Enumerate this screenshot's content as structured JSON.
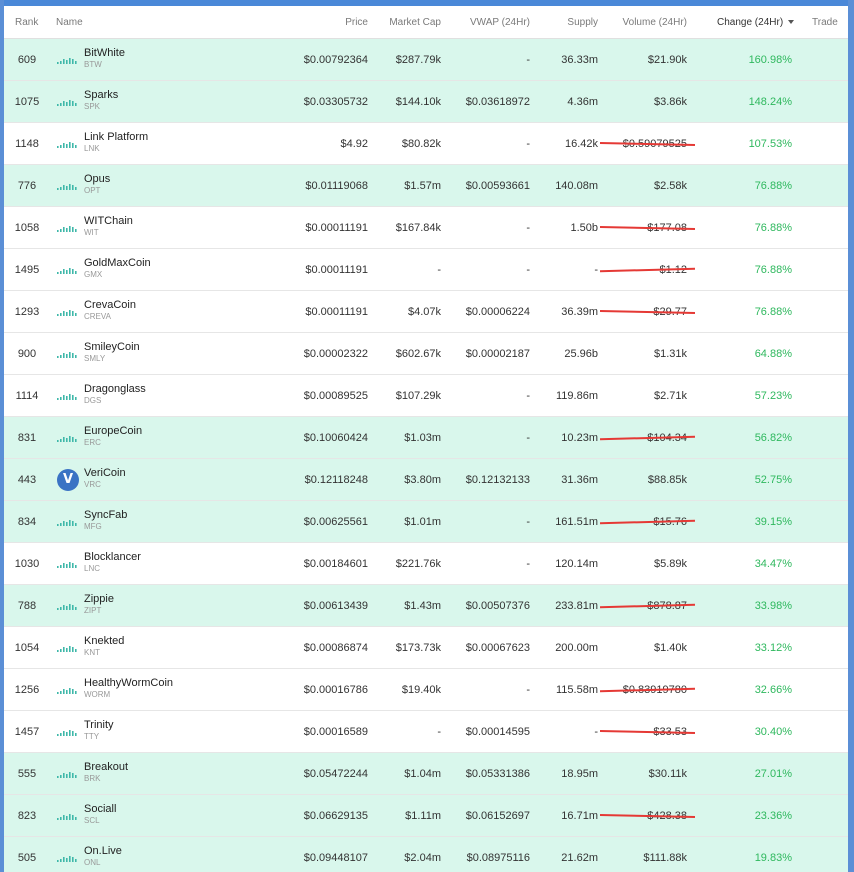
{
  "colors": {
    "accent": "#4a88d8",
    "highlight_row": "#d9f7ec",
    "positive": "#2fb85e",
    "strike": "#e53935"
  },
  "header": {
    "rank": "Rank",
    "name": "Name",
    "price": "Price",
    "market_cap": "Market Cap",
    "vwap": "VWAP (24Hr)",
    "supply": "Supply",
    "volume": "Volume (24Hr)",
    "change": "Change (24Hr)",
    "trade": "Trade",
    "sort_icon": "caret-down-icon"
  },
  "rows": [
    {
      "rank": "609",
      "name": "BitWhite",
      "symbol": "BTW",
      "price": "$0.00792364",
      "market_cap": "$287.79k",
      "vwap": "-",
      "supply": "36.33m",
      "volume": "$21.90k",
      "change": "160.98%",
      "highlight": true,
      "struck": false
    },
    {
      "rank": "1075",
      "name": "Sparks",
      "symbol": "SPK",
      "price": "$0.03305732",
      "market_cap": "$144.10k",
      "vwap": "$0.03618972",
      "supply": "4.36m",
      "volume": "$3.86k",
      "change": "148.24%",
      "highlight": true,
      "struck": false
    },
    {
      "rank": "1148",
      "name": "Link Platform",
      "symbol": "LNK",
      "price": "$4.92",
      "market_cap": "$80.82k",
      "vwap": "-",
      "supply": "16.42k",
      "volume": "$0.59079525",
      "change": "107.53%",
      "highlight": false,
      "struck": true
    },
    {
      "rank": "776",
      "name": "Opus",
      "symbol": "OPT",
      "price": "$0.01119068",
      "market_cap": "$1.57m",
      "vwap": "$0.00593661",
      "supply": "140.08m",
      "volume": "$2.58k",
      "change": "76.88%",
      "highlight": true,
      "struck": false
    },
    {
      "rank": "1058",
      "name": "WITChain",
      "symbol": "WIT",
      "price": "$0.00011191",
      "market_cap": "$167.84k",
      "vwap": "-",
      "supply": "1.50b",
      "volume": "$177.08",
      "change": "76.88%",
      "highlight": false,
      "struck": true
    },
    {
      "rank": "1495",
      "name": "GoldMaxCoin",
      "symbol": "GMX",
      "price": "$0.00011191",
      "market_cap": "-",
      "vwap": "-",
      "supply": "-",
      "volume": "$1.12",
      "change": "76.88%",
      "highlight": false,
      "struck": true
    },
    {
      "rank": "1293",
      "name": "CrevaCoin",
      "symbol": "CREVA",
      "price": "$0.00011191",
      "market_cap": "$4.07k",
      "vwap": "$0.00006224",
      "supply": "36.39m",
      "volume": "$29.77",
      "change": "76.88%",
      "highlight": false,
      "struck": true
    },
    {
      "rank": "900",
      "name": "SmileyCoin",
      "symbol": "SMLY",
      "price": "$0.00002322",
      "market_cap": "$602.67k",
      "vwap": "$0.00002187",
      "supply": "25.96b",
      "volume": "$1.31k",
      "change": "64.88%",
      "highlight": false,
      "struck": false
    },
    {
      "rank": "1114",
      "name": "Dragonglass",
      "symbol": "DGS",
      "price": "$0.00089525",
      "market_cap": "$107.29k",
      "vwap": "-",
      "supply": "119.86m",
      "volume": "$2.71k",
      "change": "57.23%",
      "highlight": false,
      "struck": false
    },
    {
      "rank": "831",
      "name": "EuropeCoin",
      "symbol": "ERC",
      "price": "$0.10060424",
      "market_cap": "$1.03m",
      "vwap": "-",
      "supply": "10.23m",
      "volume": "$104.34",
      "change": "56.82%",
      "highlight": true,
      "struck": true
    },
    {
      "rank": "443",
      "name": "VeriCoin",
      "symbol": "VRC",
      "price": "$0.12118248",
      "market_cap": "$3.80m",
      "vwap": "$0.12132133",
      "supply": "31.36m",
      "volume": "$88.85k",
      "change": "52.75%",
      "highlight": true,
      "struck": false,
      "logo": "V"
    },
    {
      "rank": "834",
      "name": "SyncFab",
      "symbol": "MFG",
      "price": "$0.00625561",
      "market_cap": "$1.01m",
      "vwap": "-",
      "supply": "161.51m",
      "volume": "$15.76",
      "change": "39.15%",
      "highlight": true,
      "struck": true
    },
    {
      "rank": "1030",
      "name": "Blocklancer",
      "symbol": "LNC",
      "price": "$0.00184601",
      "market_cap": "$221.76k",
      "vwap": "-",
      "supply": "120.14m",
      "volume": "$5.89k",
      "change": "34.47%",
      "highlight": false,
      "struck": false
    },
    {
      "rank": "788",
      "name": "Zippie",
      "symbol": "ZIPT",
      "price": "$0.00613439",
      "market_cap": "$1.43m",
      "vwap": "$0.00507376",
      "supply": "233.81m",
      "volume": "$878.87",
      "change": "33.98%",
      "highlight": true,
      "struck": true
    },
    {
      "rank": "1054",
      "name": "Knekted",
      "symbol": "KNT",
      "price": "$0.00086874",
      "market_cap": "$173.73k",
      "vwap": "$0.00067623",
      "supply": "200.00m",
      "volume": "$1.40k",
      "change": "33.12%",
      "highlight": false,
      "struck": false
    },
    {
      "rank": "1256",
      "name": "HealthyWormCoin",
      "symbol": "WORM",
      "price": "$0.00016786",
      "market_cap": "$19.40k",
      "vwap": "-",
      "supply": "115.58m",
      "volume": "$0.83919780",
      "change": "32.66%",
      "highlight": false,
      "struck": true
    },
    {
      "rank": "1457",
      "name": "Trinity",
      "symbol": "TTY",
      "price": "$0.00016589",
      "market_cap": "-",
      "vwap": "$0.00014595",
      "supply": "-",
      "volume": "$33.53",
      "change": "30.40%",
      "highlight": false,
      "struck": true
    },
    {
      "rank": "555",
      "name": "Breakout",
      "symbol": "BRK",
      "price": "$0.05472244",
      "market_cap": "$1.04m",
      "vwap": "$0.05331386",
      "supply": "18.95m",
      "volume": "$30.11k",
      "change": "27.01%",
      "highlight": true,
      "struck": false
    },
    {
      "rank": "823",
      "name": "Sociall",
      "symbol": "SCL",
      "price": "$0.06629135",
      "market_cap": "$1.11m",
      "vwap": "$0.06152697",
      "supply": "16.71m",
      "volume": "$428.38",
      "change": "23.36%",
      "highlight": true,
      "struck": true
    },
    {
      "rank": "505",
      "name": "On.Live",
      "symbol": "ONL",
      "price": "$0.09448107",
      "market_cap": "$2.04m",
      "vwap": "$0.08975116",
      "supply": "21.62m",
      "volume": "$111.88k",
      "change": "19.83%",
      "highlight": true,
      "struck": false
    }
  ]
}
